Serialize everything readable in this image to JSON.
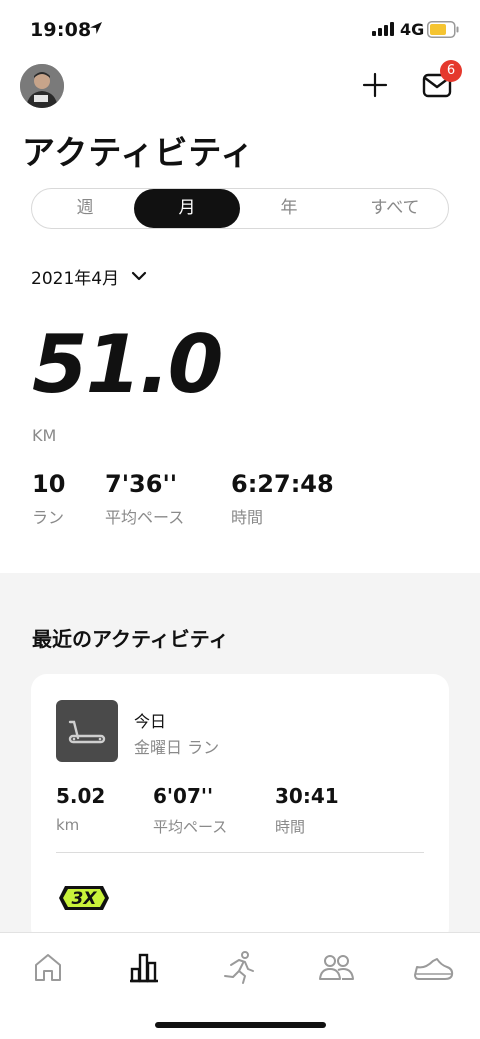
{
  "status_bar": {
    "time": "19:08",
    "network": "4G",
    "battery_color": "#f5c431"
  },
  "header": {
    "title": "アクティビティ",
    "mail_badge_count": "6"
  },
  "segments": {
    "items": [
      "週",
      "月",
      "年",
      "すべて"
    ],
    "selected": "月"
  },
  "period": {
    "label": "2021年4月"
  },
  "summary": {
    "distance": "51.0",
    "unit": "KM",
    "runs_value": "10",
    "runs_label": "ラン",
    "pace_value": "7'36''",
    "pace_label": "平均ペース",
    "time_value": "6:27:48",
    "time_label": "時間"
  },
  "recent": {
    "title": "最近のアクティビティ",
    "card": {
      "date": "今日",
      "subtitle": "金曜日 ラン",
      "distance_value": "5.02",
      "distance_unit": "km",
      "pace_value": "6'07''",
      "pace_label": "平均ペース",
      "time_value": "30:41",
      "time_label": "時間",
      "badge_icon": "3x-achievement-badge"
    }
  },
  "tabbar": {
    "items": [
      "home-icon",
      "activity-chart-icon",
      "run-icon",
      "community-icon",
      "shoe-icon"
    ],
    "active": "activity-chart-icon"
  },
  "colors": {
    "accent_dark": "#111111",
    "badge_red": "#e5392d",
    "muted_text": "#8a8a8a",
    "section_bg": "#f4f4f4",
    "achievement_green": "#c9f23a"
  }
}
